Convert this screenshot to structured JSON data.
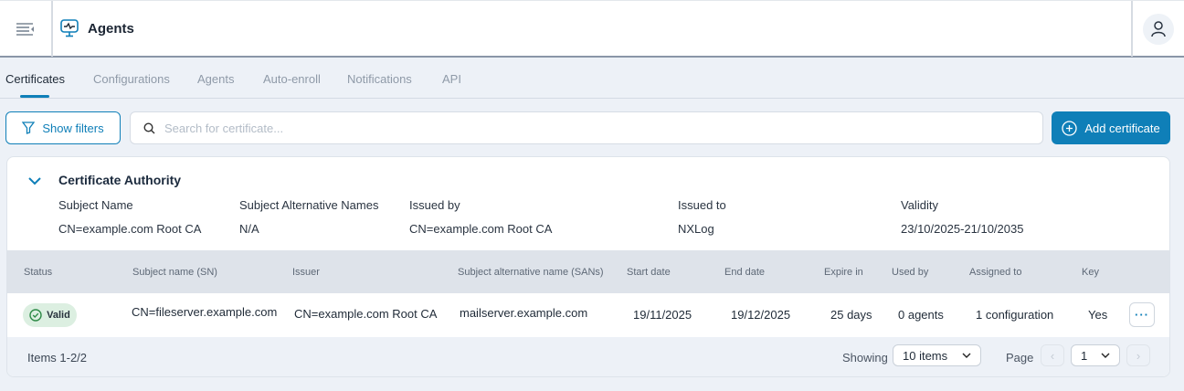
{
  "header": {
    "title": "Agents",
    "menu_icon": "collapse-menu-icon",
    "title_icon": "monitor-pulse-icon",
    "user_icon": "user-icon"
  },
  "tabs": [
    {
      "label": "Certificates",
      "active": true
    },
    {
      "label": "Configurations"
    },
    {
      "label": "Agents"
    },
    {
      "label": "Auto-enroll"
    },
    {
      "label": "Notifications"
    },
    {
      "label": "API"
    }
  ],
  "toolbar": {
    "filters_label": "Show filters",
    "search_placeholder": "Search for certificate...",
    "search_value": "",
    "add_label": "Add certificate"
  },
  "ca": {
    "title": "Certificate Authority",
    "fields": [
      {
        "label": "Subject Name",
        "value": "CN=example.com Root CA"
      },
      {
        "label": "Subject Alternative Names",
        "value": "N/A"
      },
      {
        "label": "Issued by",
        "value": "CN=example.com Root CA"
      },
      {
        "label": "Issued to",
        "value": "NXLog"
      },
      {
        "label": "Validity",
        "value": "23/10/2025-21/10/2035"
      }
    ]
  },
  "table": {
    "columns": [
      "Status",
      "Subject name (SN)",
      "Issuer",
      "Subject alternative name (SANs)",
      "Start date",
      "End date",
      "Expire in",
      "Used by",
      "Assigned to",
      "Key"
    ],
    "rows": [
      {
        "status": "Valid",
        "sn": "CN=fileserver.example.com",
        "issuer": "CN=example.com Root CA",
        "sans": "mailserver.example.com",
        "start": "19/11/2025",
        "end": "19/12/2025",
        "expire": "25 days",
        "used_by": "0 agents",
        "assigned": "1 configuration",
        "key": "Yes"
      }
    ]
  },
  "footer": {
    "items": "Items 1-2/2",
    "showing_label": "Showing",
    "showing_value": "10 items",
    "page_label": "Page",
    "page_value": "1"
  },
  "colors": {
    "accent": "#0f7fb8",
    "valid_bg": "#dcefe1",
    "valid_icon": "#2e8a47"
  }
}
